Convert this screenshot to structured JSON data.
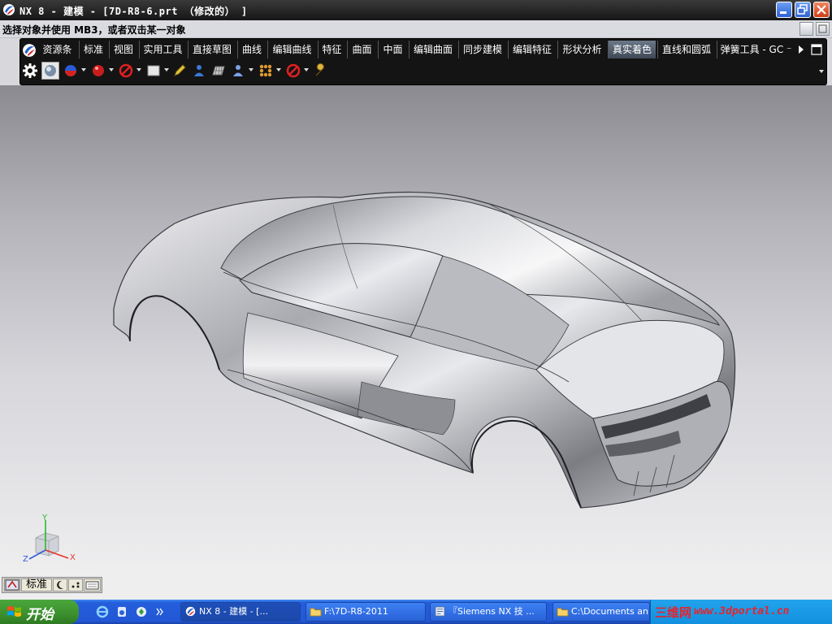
{
  "window": {
    "title": "NX 8 - 建模 - [7D-R8-6.prt （修改的） ]"
  },
  "prompt": {
    "text": "选择对象并使用 MB3，或者双击某一对象"
  },
  "ribbon": {
    "tabs": [
      "资源条",
      "标准",
      "视图",
      "实用工具",
      "直接草图",
      "曲线",
      "编辑曲线",
      "特征",
      "曲面",
      "中面",
      "编辑曲面",
      "同步建模",
      "编辑特征",
      "形状分析",
      "真实着色",
      "直线和圆弧",
      "弹簧工具 - GC ⁻"
    ],
    "active_tab": "真实着色"
  },
  "ime": {
    "mode_label": "标准"
  },
  "taskbar": {
    "start_label": "开始",
    "buttons": [
      "NX 8 - 建模 - [...",
      "F:\\7D-R8-2011",
      "『Siemens NX 技 ...",
      "C:\\Documents an..."
    ]
  },
  "watermark": {
    "brand": "三维网",
    "url": "www.3dportal.cn"
  },
  "axes": {
    "x": "X",
    "y": "Y",
    "z": "Z"
  }
}
